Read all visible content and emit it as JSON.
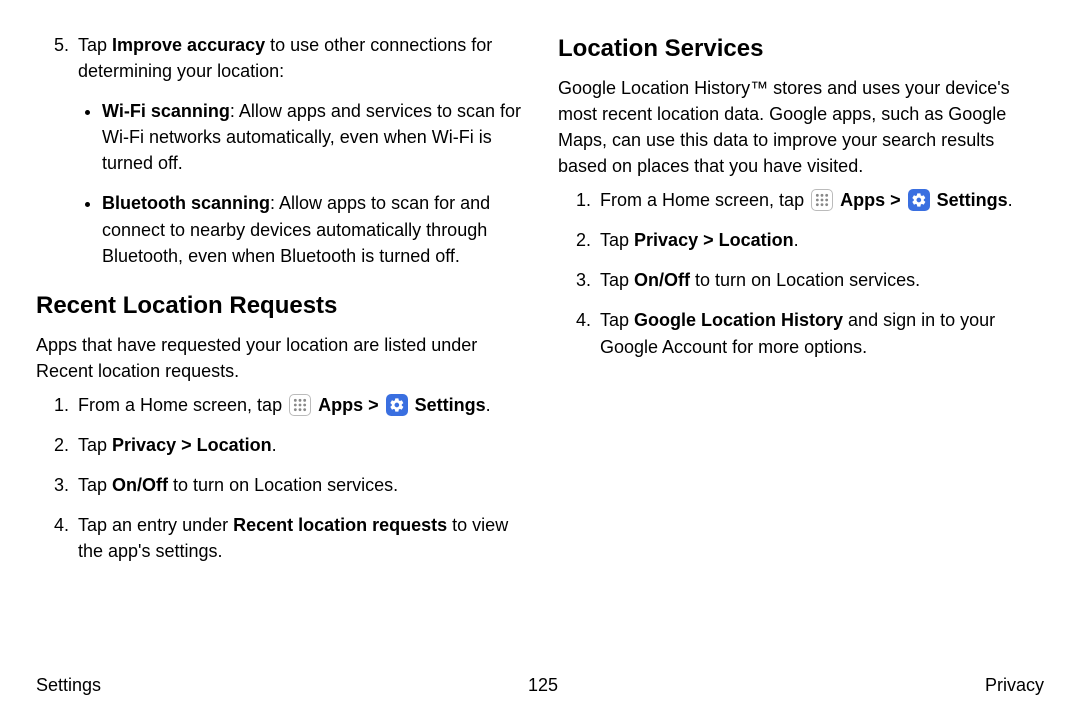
{
  "left": {
    "step5_a": "Tap ",
    "step5_b": "Improve accuracy",
    "step5_c": " to use other connections for determining your location:",
    "bullet1_a": "Wi-Fi scanning",
    "bullet1_b": ": Allow apps and services to scan for Wi-Fi networks automatically, even when Wi-Fi is turned off.",
    "bullet2_a": "Bluetooth scanning",
    "bullet2_b": ": Allow apps to scan for and connect to nearby devices automatically through Bluetooth, even when Bluetooth is turned off.",
    "heading": "Recent Location Requests",
    "intro": "Apps that have requested your location are listed under Recent location requests.",
    "s1_a": "From a Home screen, tap ",
    "s1_apps": "Apps",
    "s1_sep": " > ",
    "s1_settings": "Settings",
    "s1_end": ".",
    "s2_a": "Tap ",
    "s2_b": "Privacy",
    "s2_c": " > ",
    "s2_d": "Location",
    "s2_e": ".",
    "s3_a": "Tap ",
    "s3_b": "On/Off",
    "s3_c": " to turn on Location services.",
    "s4_a": "Tap an entry under ",
    "s4_b": "Recent location requests",
    "s4_c": " to view the app's settings."
  },
  "right": {
    "heading": "Location Services",
    "intro": "Google Location History™ stores and uses your device's most recent location data. Google apps, such as Google Maps, can use this data to improve your search results based on places that you have visited.",
    "s1_a": "From a Home screen, tap ",
    "s1_apps": "Apps",
    "s1_sep": " > ",
    "s1_settings": "Settings",
    "s1_end": ".",
    "s2_a": "Tap ",
    "s2_b": "Privacy",
    "s2_c": " > ",
    "s2_d": "Location",
    "s2_e": ".",
    "s3_a": "Tap ",
    "s3_b": "On/Off",
    "s3_c": " to turn on Location services.",
    "s4_a": "Tap ",
    "s4_b": "Google Location History",
    "s4_c": " and sign in to your Google Account for more options."
  },
  "footer": {
    "left": "Settings",
    "center": "125",
    "right": "Privacy"
  }
}
